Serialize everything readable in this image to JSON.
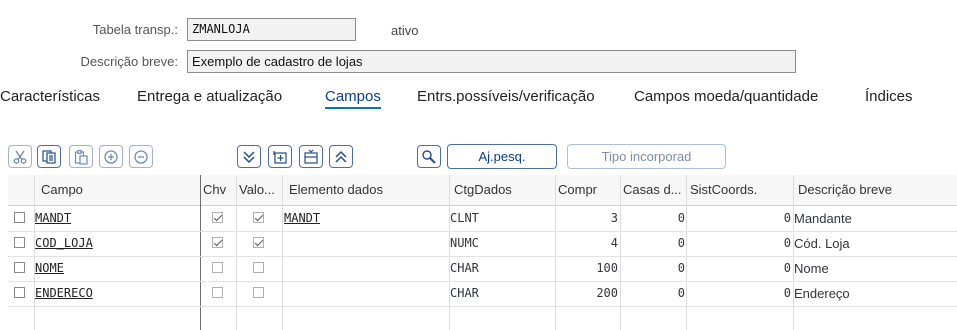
{
  "form": {
    "tabela_label": "Tabela transp.:",
    "tabela_value": "ZMANLOJA",
    "status": "ativo",
    "descricao_label": "Descrição breve:",
    "descricao_value": "Exemplo de cadastro de lojas"
  },
  "tabs": [
    {
      "label": "Características"
    },
    {
      "label": "Entrega e atualização"
    },
    {
      "label": "Campos"
    },
    {
      "label": "Entrs.possíveis/verificação"
    },
    {
      "label": "Campos moeda/quantidade"
    },
    {
      "label": "Índices"
    }
  ],
  "toolbar": {
    "icons": [
      "cut-icon",
      "copy-icon",
      "paste-icon",
      "insert-row-icon",
      "delete-row-icon",
      "expand-all-icon",
      "insert-field-icon",
      "include-structure-icon",
      "collapse-all-icon",
      "search-help-icon"
    ],
    "search_help_label": "Aj.pesq.",
    "built_in_type_label": "Tipo incorporad"
  },
  "table": {
    "columns": [
      "Campo",
      "Chv",
      "Valo...",
      "Elemento dados",
      "CtgDados",
      "Compr",
      "Casas d...",
      "SistCoords.",
      "Descrição breve"
    ],
    "rows": [
      {
        "campo": "MANDT",
        "chv": true,
        "valo": true,
        "elemento": "MANDT",
        "tipo": "CLNT",
        "compr": "3",
        "casas": "0",
        "coords": "0",
        "descricao": "Mandante"
      },
      {
        "campo": "COD_LOJA",
        "chv": true,
        "valo": true,
        "elemento": "",
        "tipo": "NUMC",
        "compr": "4",
        "casas": "0",
        "coords": "0",
        "descricao": "Cód. Loja"
      },
      {
        "campo": "NOME",
        "chv": false,
        "valo": false,
        "elemento": "",
        "tipo": "CHAR",
        "compr": "100",
        "casas": "0",
        "coords": "0",
        "descricao": "Nome"
      },
      {
        "campo": "ENDERECO",
        "chv": false,
        "valo": false,
        "elemento": "",
        "tipo": "CHAR",
        "compr": "200",
        "casas": "0",
        "coords": "0",
        "descricao": "Endereço"
      }
    ]
  }
}
